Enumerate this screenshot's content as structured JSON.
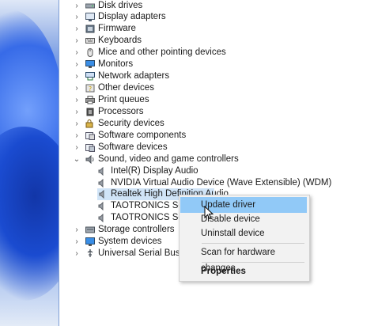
{
  "device_manager": {
    "categories": [
      {
        "label": "Disk drives",
        "icon": "disk-drive-icon"
      },
      {
        "label": "Display adapters",
        "icon": "display-adapter-icon"
      },
      {
        "label": "Firmware",
        "icon": "firmware-icon"
      },
      {
        "label": "Keyboards",
        "icon": "keyboard-icon"
      },
      {
        "label": "Mice and other pointing devices",
        "icon": "mouse-icon"
      },
      {
        "label": "Monitors",
        "icon": "monitor-icon"
      },
      {
        "label": "Network adapters",
        "icon": "network-adapter-icon"
      },
      {
        "label": "Other devices",
        "icon": "other-devices-icon"
      },
      {
        "label": "Print queues",
        "icon": "printer-icon"
      },
      {
        "label": "Processors",
        "icon": "processor-icon"
      },
      {
        "label": "Security devices",
        "icon": "security-device-icon"
      },
      {
        "label": "Software components",
        "icon": "software-component-icon"
      },
      {
        "label": "Software devices",
        "icon": "software-device-icon"
      },
      {
        "label": "Sound, video and game controllers",
        "icon": "speaker-icon",
        "expanded": true
      },
      {
        "label": "Storage controllers",
        "icon": "storage-controller-icon"
      },
      {
        "label": "System devices",
        "icon": "system-devices-icon"
      },
      {
        "label": "Universal Serial Bus cont",
        "icon": "usb-icon"
      }
    ],
    "sound_children": [
      {
        "label": "Intel(R) Display Audio"
      },
      {
        "label": "NVIDIA Virtual Audio Device (Wave Extensible) (WDM)"
      },
      {
        "label": "Realtek High Definition Audio",
        "selected": true
      },
      {
        "label": "TAOTRONICS Sound"
      },
      {
        "label": "TAOTRONICS Sound"
      }
    ]
  },
  "context_menu": {
    "update_driver": "Update driver",
    "disable_device": "Disable device",
    "uninstall_device": "Uninstall device",
    "scan_hardware": "Scan for hardware changes",
    "properties": "Properties"
  },
  "colors": {
    "selection": "#d0e4f7",
    "menu_hover": "#91c9f7",
    "menu_bg": "#f2f2f2"
  }
}
